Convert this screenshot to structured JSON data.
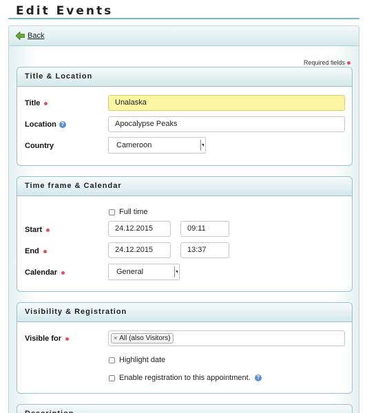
{
  "page": {
    "title": "Edit Events"
  },
  "toolbar": {
    "back_label": "Back"
  },
  "required_note": "Required fields",
  "title_location": {
    "heading": "Title & Location",
    "title_label": "Title",
    "title_value": "Unalaska",
    "location_label": "Location",
    "location_value": "Apocalypse Peaks",
    "country_label": "Country",
    "country_value": "Cameroon"
  },
  "timeframe": {
    "heading": "Time frame & Calendar",
    "full_time_label": "Full time",
    "start_label": "Start",
    "start_date": "24.12.2015",
    "start_time": "09:11",
    "end_label": "End",
    "end_date": "24.12.2015",
    "end_time": "13:37",
    "calendar_label": "Calendar",
    "calendar_value": "General"
  },
  "visibility": {
    "heading": "Visibility & Registration",
    "visible_label": "Visible for",
    "visible_chip": "All (also Visitors)",
    "highlight_label": "Highlight date",
    "registration_label": "Enable registration to this appointment."
  },
  "description": {
    "heading": "Description"
  },
  "colors": {
    "accent": "#7fb6be",
    "required": "#e0505a",
    "focus_bg": "#fbf4a2"
  }
}
